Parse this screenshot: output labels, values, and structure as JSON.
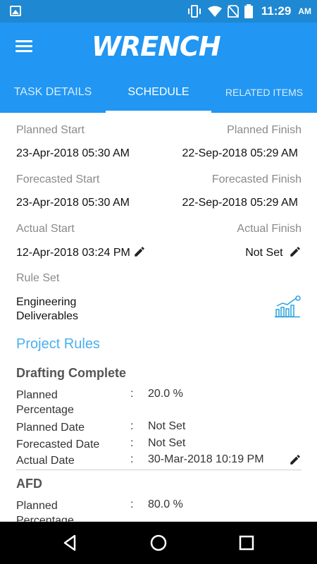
{
  "status_bar": {
    "time": "11:29",
    "ampm": "AM"
  },
  "app": {
    "logo_text": "WRENCH"
  },
  "tabs": [
    {
      "label": "TASK DETAILS",
      "active": false
    },
    {
      "label": "SCHEDULE",
      "active": true
    },
    {
      "label": "RELATED ITEMS",
      "active": false
    }
  ],
  "schedule": {
    "planned_start_label": "Planned Start",
    "planned_finish_label": "Planned Finish",
    "planned_start": "23-Apr-2018 05:30 AM",
    "planned_finish": "22-Sep-2018 05:29 AM",
    "forecasted_start_label": "Forecasted Start",
    "forecasted_finish_label": "Forecasted Finish",
    "forecasted_start": "23-Apr-2018 05:30 AM",
    "forecasted_finish": "22-Sep-2018 05:29 AM",
    "actual_start_label": "Actual Start",
    "actual_finish_label": "Actual Finish",
    "actual_start": "12-Apr-2018 03:24 PM",
    "actual_finish": "Not Set",
    "rule_set_label": "Rule Set",
    "rule_set_line1": "Engineering",
    "rule_set_line2": "Deliverables"
  },
  "project_rules": {
    "title": "Project Rules",
    "rules": [
      {
        "name": "Drafting Complete",
        "planned_percentage_label_1": "Planned",
        "planned_percentage_label_2": "Percentage",
        "planned_percentage": "20.0 %",
        "planned_date_label": "Planned Date",
        "planned_date": "Not Set",
        "forecasted_date_label": "Forecasted Date",
        "forecasted_date": "Not Set",
        "actual_date_label": "Actual Date",
        "actual_date": "30-Mar-2018 10:19 PM"
      },
      {
        "name": "AFD",
        "planned_percentage_label_1": "Planned",
        "planned_percentage_label_2": "Percentage",
        "planned_percentage": "80.0 %"
      }
    ],
    "colon": ":"
  },
  "colors": {
    "status_bar": "#1e88d2",
    "app_bar": "#2196f3",
    "accent": "#4ab0ec"
  }
}
